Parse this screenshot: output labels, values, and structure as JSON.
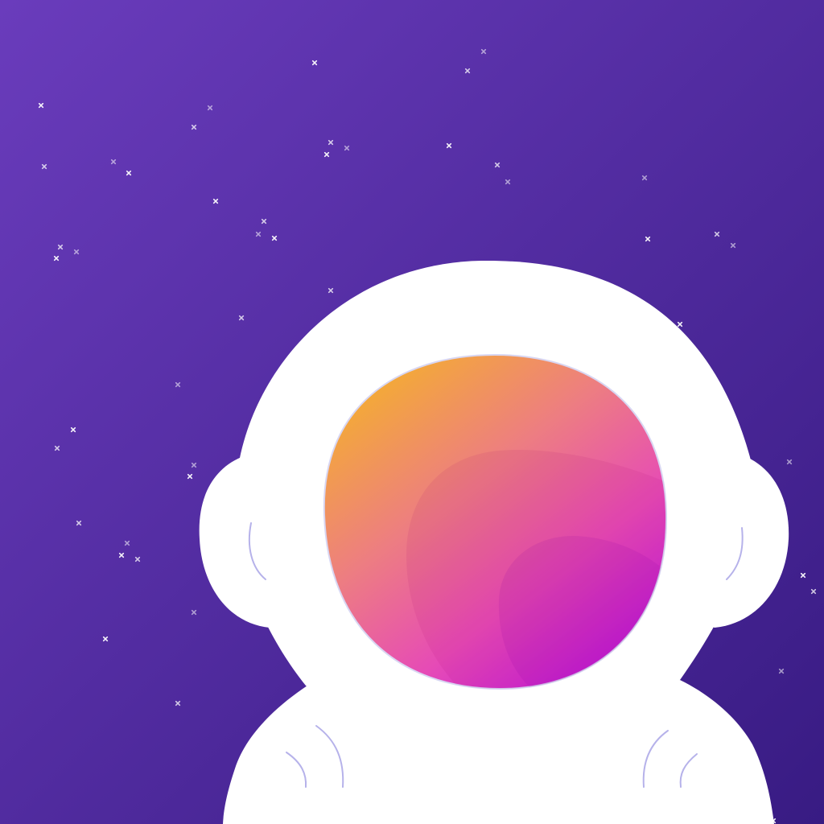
{
  "scene": {
    "background": {
      "color_top_left": "#6a3cbc",
      "color_bottom_right": "#381b83"
    },
    "stars": {
      "color": "#ffffff"
    },
    "astronaut": {
      "suit_color": "#ffffff",
      "detail_line_color": "#b6b2ea",
      "visor_colors": [
        "#f4ad32",
        "#ed7d82",
        "#e64bb6",
        "#c21bdc"
      ]
    }
  }
}
